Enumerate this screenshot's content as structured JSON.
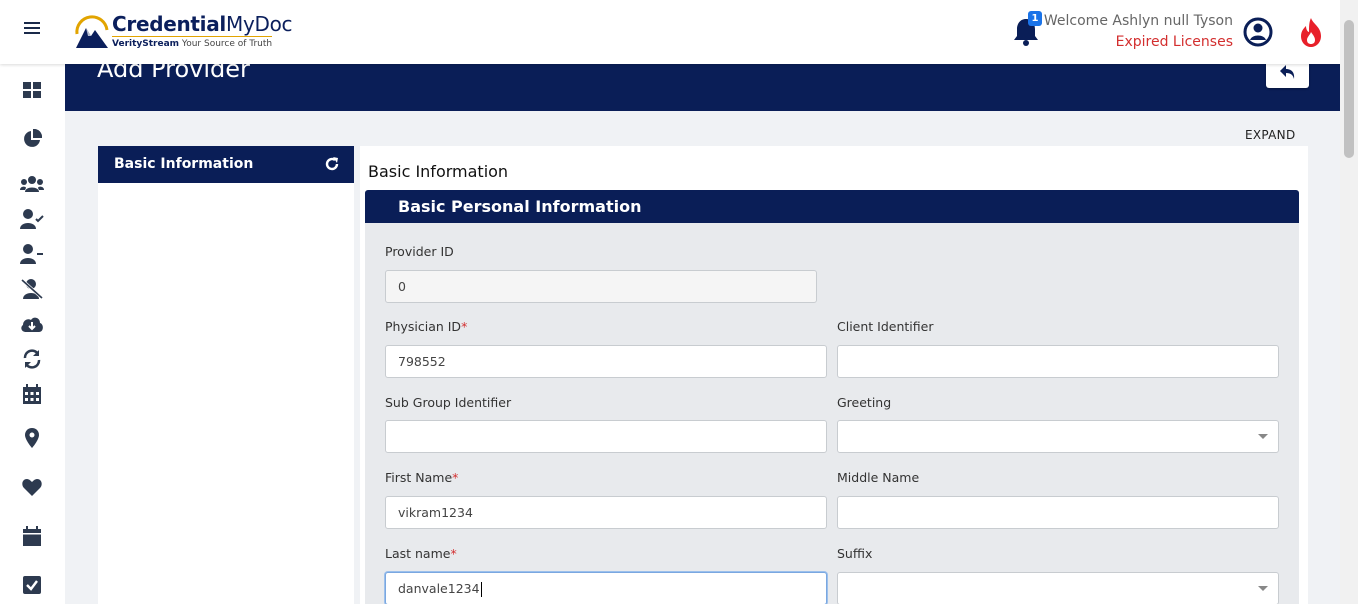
{
  "header": {
    "brand_bold": "Credential",
    "brand_light": "MyDoc",
    "tag_bold": "VerityStream",
    "tag_rest": " Your Source of Truth",
    "notification_count": "1",
    "welcome": "Welcome Ashlyn null Tyson",
    "expired_link": "Expired Licenses"
  },
  "page": {
    "title": "Add Provider",
    "expand": "EXPAND"
  },
  "left_panel": {
    "tab_label": "Basic Information"
  },
  "form": {
    "section_title": "Basic Information",
    "subsection_title": "Basic Personal Information",
    "provider_id": {
      "label": "Provider ID",
      "value": "0"
    },
    "physician_id": {
      "label": "Physician ID",
      "required": "*",
      "value": "798552"
    },
    "client_identifier": {
      "label": "Client Identifier",
      "value": ""
    },
    "sub_group_identifier": {
      "label": "Sub Group Identifier",
      "value": ""
    },
    "greeting": {
      "label": "Greeting",
      "value": ""
    },
    "first_name": {
      "label": "First Name",
      "required": "*",
      "value": "vikram1234"
    },
    "middle_name": {
      "label": "Middle Name",
      "value": ""
    },
    "last_name": {
      "label": "Last name",
      "required": "*",
      "value": "danvale1234"
    },
    "suffix": {
      "label": "Suffix",
      "value": ""
    }
  },
  "colors": {
    "navy": "#0a1e57",
    "required": "#d32f2f",
    "badge": "#1a73e8",
    "fire": "#e8202a"
  },
  "icons": {
    "rail": [
      "dashboard-icon",
      "pie-chart-icon",
      "users-icon",
      "user-check-icon",
      "user-minus-icon",
      "user-slash-icon",
      "cloud-download-icon",
      "sync-icon",
      "calendar-icon",
      "map-marker-icon",
      "heart-icon",
      "calendar-alt-icon",
      "checkbox-icon"
    ]
  }
}
